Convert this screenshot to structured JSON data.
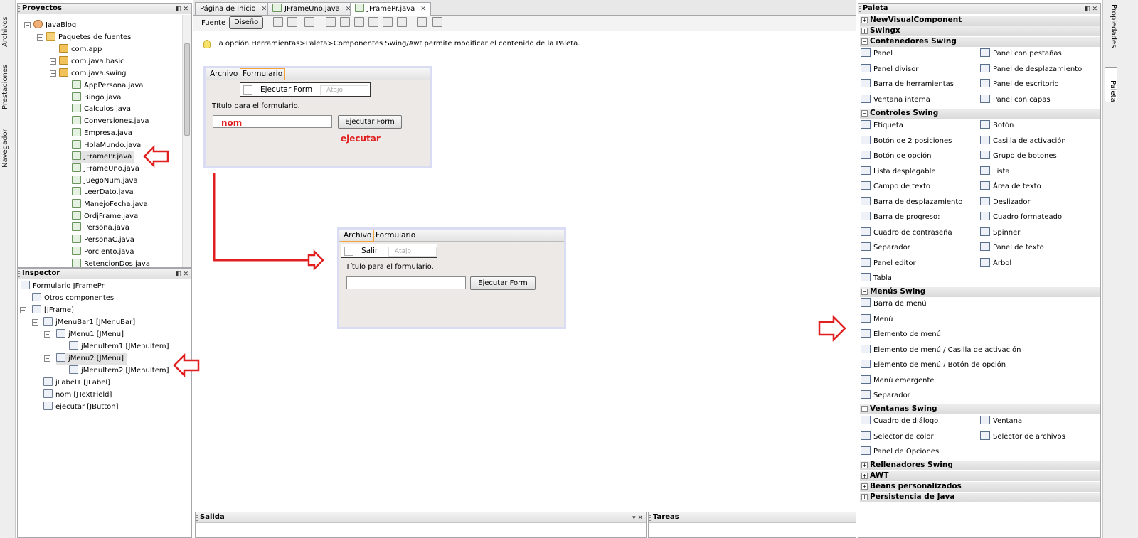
{
  "left_sidebar": {
    "tabs": [
      "Archivos",
      "Prestaciones",
      "Navegador"
    ]
  },
  "right_sidebar": {
    "tabs": [
      "Propiedades",
      "Paleta"
    ]
  },
  "projects": {
    "title": "Proyectos",
    "root": "JavaBlog",
    "source_packages": "Paquetes de fuentes",
    "packages": [
      "com.app",
      "com.java.basic",
      "com.java.swing"
    ],
    "files": [
      "AppPersona.java",
      "Bingo.java",
      "Calculos.java",
      "Conversiones.java",
      "Empresa.java",
      "HolaMundo.java",
      "JFramePr.java",
      "JFrameUno.java",
      "JuegoNum.java",
      "LeerDato.java",
      "ManejoFecha.java",
      "OrdjFrame.java",
      "Persona.java",
      "PersonaC.java",
      "Porciento.java",
      "RetencionDos.java"
    ]
  },
  "inspector": {
    "title": "Inspector",
    "nodes": [
      "Formulario JFramePr",
      "Otros componentes",
      "[JFrame]",
      "jMenuBar1 [JMenuBar]",
      "jMenu1 [JMenu]",
      "jMenuItem1 [JMenuItem]",
      "jMenu2 [JMenu]",
      "jMenuItem2 [JMenuItem]",
      "jLabel1 [JLabel]",
      "nom [JTextField]",
      "ejecutar [JButton]"
    ]
  },
  "editor": {
    "tabs": [
      "Página de Inicio",
      "JFrameUno.java",
      "JFramePr.java"
    ],
    "mode_buttons": [
      "Fuente",
      "Diseño"
    ],
    "info_text": "La opción Herramientas>Paleta>Componentes Swing/Awt permite modificar el contenido de la Paleta."
  },
  "form1": {
    "menus": [
      "Archivo",
      "Formulario"
    ],
    "popup_item": "Ejecutar Form",
    "popup_accel": "Atajo",
    "label": "Título para el formulario.",
    "button": "Ejecutar Form",
    "annot_field": "nom",
    "annot_button": "ejecutar"
  },
  "form2": {
    "menus": [
      "Archivo",
      "Formulario"
    ],
    "popup_item": "Salir",
    "popup_accel": "Atajo",
    "label": "Título para el formulario.",
    "button": "Ejecutar Form"
  },
  "bottom": {
    "output": "Salida",
    "tasks": "Tareas"
  },
  "palette": {
    "title": "Paleta",
    "categories": {
      "nvc": "NewVisualComponent",
      "swingx": "Swingx",
      "containers": "Contenedores Swing",
      "controls": "Controles Swing",
      "menus": "Menús Swing",
      "windows": "Ventanas Swing",
      "fillers": "Rellenadores Swing",
      "awt": "AWT",
      "beans": "Beans personalizados",
      "persist": "Persistencia de Java"
    },
    "containers": [
      "Panel",
      "Panel con pestañas",
      "Panel divisor",
      "Panel de desplazamiento",
      "Barra de herramientas",
      "Panel de escritorio",
      "Ventana interna",
      "Panel con capas"
    ],
    "controls": [
      "Etiqueta",
      "Botón",
      "Botón de 2 posiciones",
      "Casilla de activación",
      "Botón de opción",
      "Grupo de botones",
      "Lista desplegable",
      "Lista",
      "Campo de texto",
      "Área de texto",
      "Barra de desplazamiento",
      "Deslizador",
      "Barra de progreso:",
      "Cuadro formateado",
      "Cuadro de contraseña",
      "Spinner",
      "Separador",
      "Panel de texto",
      "Panel editor",
      "Árbol",
      "Tabla"
    ],
    "menus": [
      "Barra de menú",
      "Menú",
      "Elemento de menú",
      "Elemento de menú / Casilla de activación",
      "Elemento de menú / Botón de opción",
      "Menú emergente",
      "Separador"
    ],
    "windows": [
      "Cuadro de diálogo",
      "Ventana",
      "Selector de color",
      "Selector de archivos",
      "Panel de Opciones"
    ]
  },
  "colors": {
    "annotation_red": "#e02020",
    "menu_highlight": "#f2a33c",
    "frame_border": "#d9dcf3"
  }
}
